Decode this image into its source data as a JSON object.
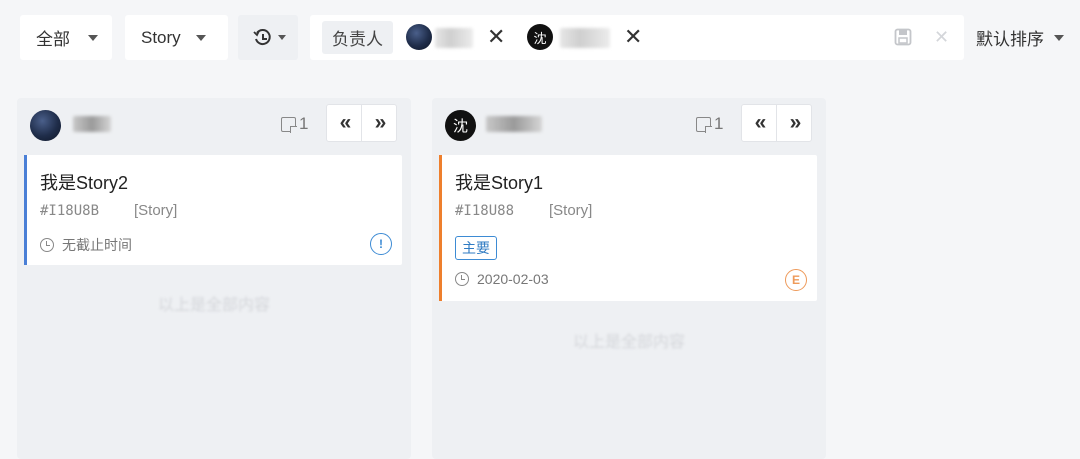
{
  "toolbar": {
    "scope_label": "全部",
    "type_label": "Story",
    "history_icon": "history-icon",
    "filter_label": "负责人",
    "sort_label": "默认排序"
  },
  "filter_chips": [
    {
      "avatar_text": "",
      "avatar_style": "dark"
    },
    {
      "avatar_text": "沈",
      "avatar_style": "black"
    }
  ],
  "columns": [
    {
      "avatar_text": "",
      "count": "1",
      "nav_prev": "«",
      "nav_next": "»",
      "cards": [
        {
          "title": "我是Story2",
          "id": "#I18U8B",
          "type": "[Story]",
          "tag": "",
          "due": "无截止时间",
          "bar_color": "#4a7fd6",
          "status_color": "#3d8bd4"
        }
      ],
      "footer": "以上是全部内容"
    },
    {
      "avatar_text": "沈",
      "count": "1",
      "nav_prev": "«",
      "nav_next": "»",
      "cards": [
        {
          "title": "我是Story1",
          "id": "#I18U88",
          "type": "[Story]",
          "tag": "主要",
          "due": "2020-02-03",
          "bar_color": "#ee7f2d",
          "status_color": "#ee9a5a"
        }
      ],
      "footer": "以上是全部内容"
    }
  ]
}
